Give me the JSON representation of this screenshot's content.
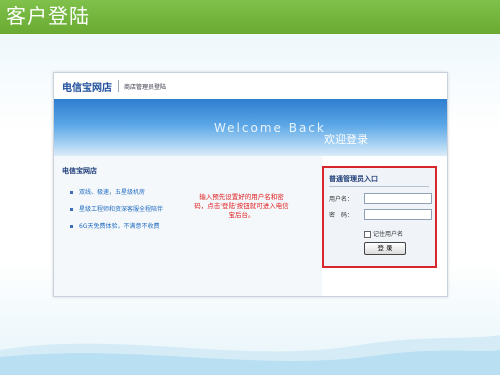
{
  "slide": {
    "title": "客户登陆"
  },
  "site": {
    "name": "电信宝网店",
    "subtitle": "商店管理员登陆"
  },
  "banner": {
    "welcome_text": "Welcome Back",
    "login_text": "欢迎登录"
  },
  "left_panel": {
    "title": "电信宝网店",
    "features": [
      "双线、极速，五星级机房",
      "星级工程师和资深客服全程陪伴",
      "6G天免费体验，不满意不收费"
    ]
  },
  "annotation": {
    "text": "输入预先设置好的用户名和密码，点击'登陆'按钮就可进入电信宝后台。"
  },
  "login": {
    "title": "普通管理员入口",
    "username_label": "用户名：",
    "password_label": "密　码：",
    "username_value": "",
    "password_value": "",
    "remember_label": "记住用户名",
    "button_label": "登 录"
  },
  "colors": {
    "header_green": "#6aaa33",
    "highlight_red": "#d7262c",
    "link_blue": "#1f6bc1"
  }
}
